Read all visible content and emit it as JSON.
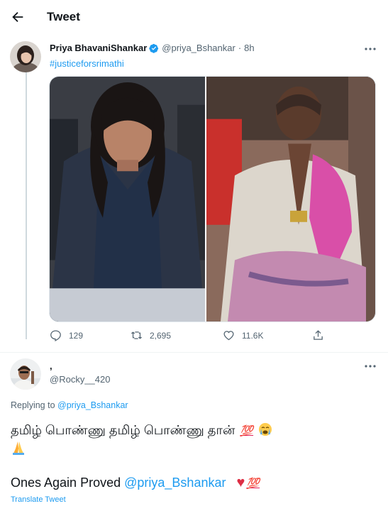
{
  "header": {
    "title": "Tweet"
  },
  "tweet": {
    "author_name": "Priya BhavaniShankar",
    "handle": "@priya_Bshankar",
    "separator": "·",
    "time": "8h",
    "hashtag": "#justiceforsrimathi",
    "stats": {
      "replies": "129",
      "retweets": "2,695",
      "likes": "11.6K"
    }
  },
  "reply": {
    "author_name": ",",
    "handle": "@Rocky__420",
    "replying_to_prefix": "Replying to",
    "replying_to_handle": "@priya_Bshankar",
    "text_line1": "தமிழ் பொண்ணு தமிழ் பொண்ணு தான்",
    "hundred_emoji": "💯",
    "text_line2_prefix": "Ones Again Proved",
    "mention": "@priya_Bshankar",
    "heart": "♥",
    "translate": "Translate Tweet"
  },
  "icons": [
    "back-arrow-icon",
    "verified-badge-icon",
    "more-icon",
    "reply-icon",
    "retweet-icon",
    "like-icon",
    "share-icon"
  ],
  "colors": {
    "accent": "#1d9bf0",
    "muted": "#536471",
    "heart": "#dd2e44"
  }
}
